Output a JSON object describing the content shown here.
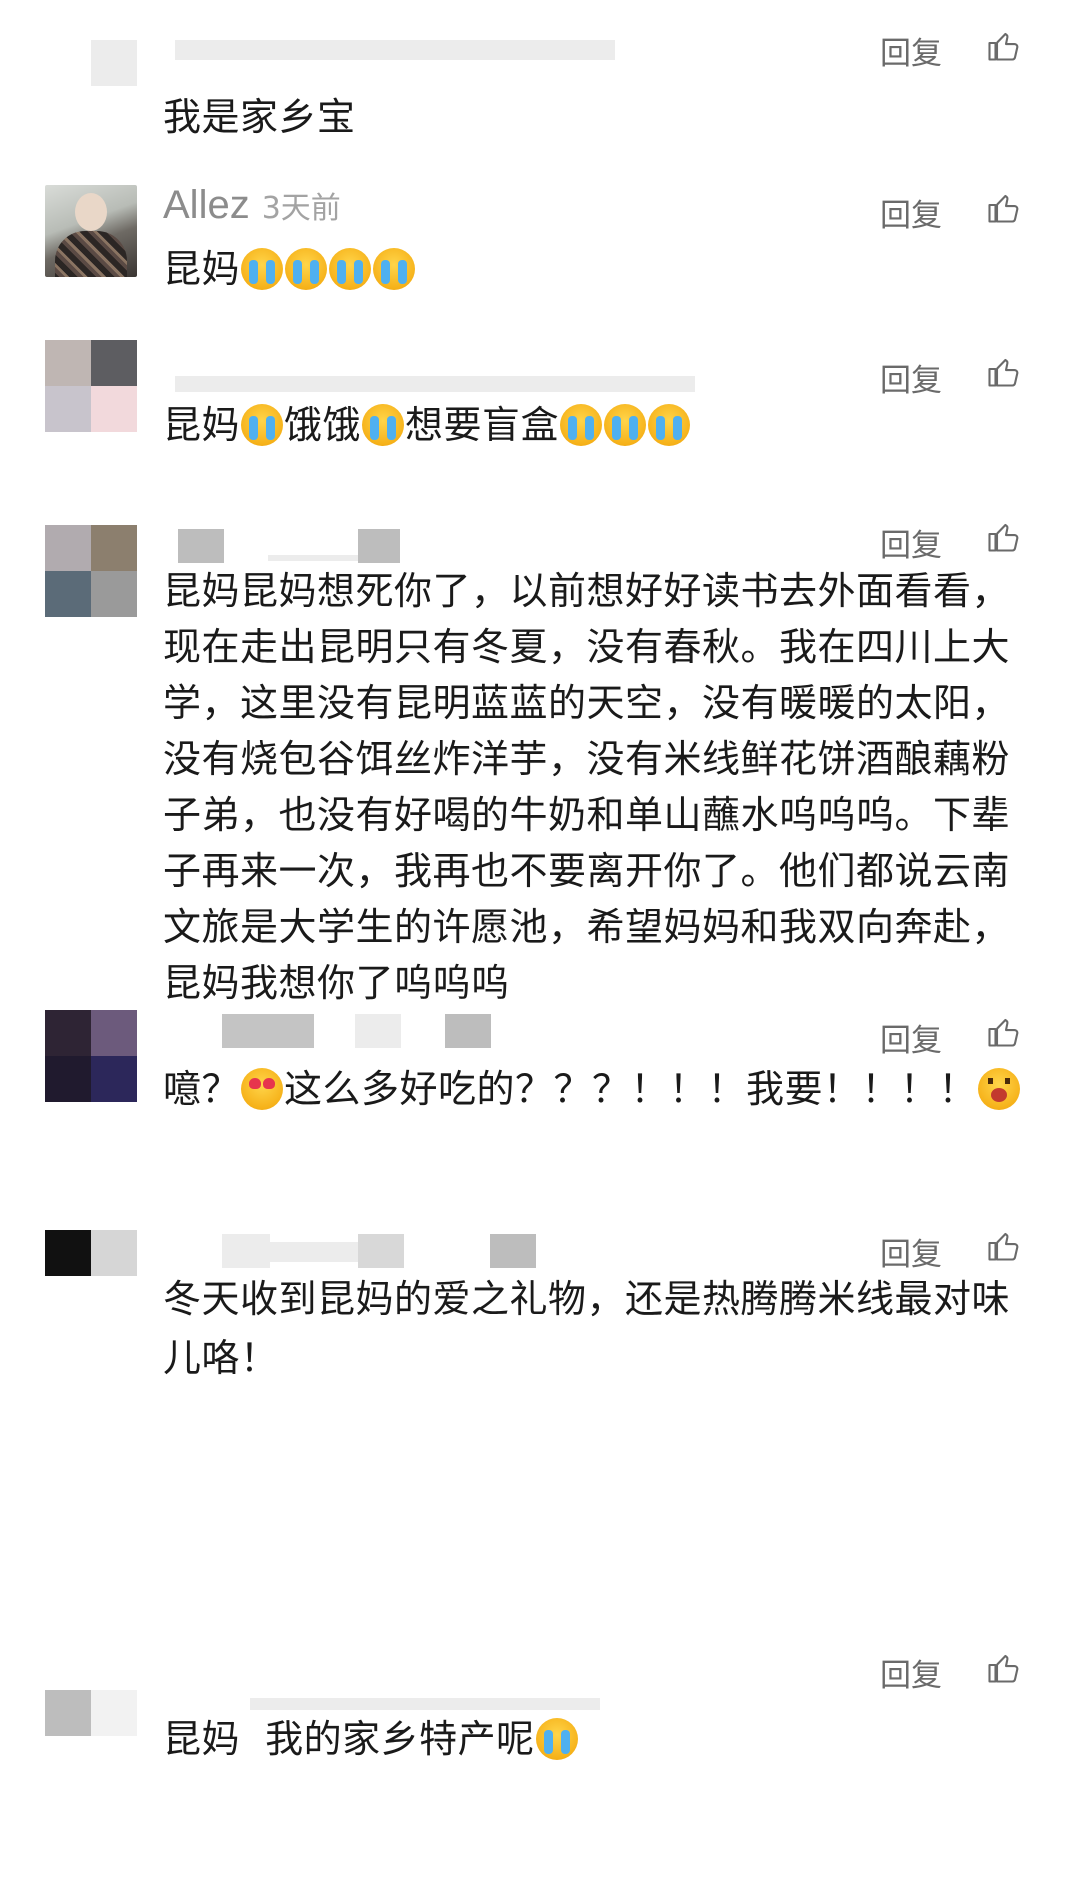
{
  "actions": {
    "reply_label": "回复"
  },
  "comments": [
    {
      "username": "",
      "time": "",
      "text": "我是家乡宝",
      "emojis": []
    },
    {
      "username": "Allez",
      "time": "3天前",
      "text": "昆妈",
      "emojis": [
        "loudly-crying-face",
        "loudly-crying-face",
        "loudly-crying-face",
        "loudly-crying-face"
      ]
    },
    {
      "username": "",
      "time": "",
      "segments": [
        "昆妈",
        "饿饿",
        "想要盲盒"
      ],
      "emojis": [
        "loudly-crying-face",
        "loudly-crying-face",
        "loudly-crying-face",
        "loudly-crying-face",
        "loudly-crying-face"
      ]
    },
    {
      "username": "",
      "time": "",
      "text": "昆妈昆妈想死你了，以前想好好读书去外面看看，现在走出昆明只有冬夏，没有春秋。我在四川上大学，这里没有昆明蓝蓝的天空，没有暖暖的太阳，没有烧包谷饵丝炸洋芋，没有米线鲜花饼酒酿藕粉子弟，也没有好喝的牛奶和单山蘸水呜呜呜。下辈子再来一次，我再也不要离开你了。他们都说云南文旅是大学生的许愿池，希望妈妈和我双向奔赴，昆妈我想你了呜呜呜",
      "emojis": []
    },
    {
      "username": "",
      "time": "",
      "segments": [
        "噫？",
        "这么多好吃的？？？！！！我要！！！！"
      ],
      "emojis": [
        "smiling-face-with-heart-eyes",
        "drooling-face"
      ]
    },
    {
      "username": "",
      "time": "",
      "text": "冬天收到昆妈的爱之礼物，还是热腾腾米线最对味儿咯！",
      "emojis": []
    },
    {
      "username": "",
      "time": "",
      "text": "昆妈  我的家乡特产呢",
      "emojis": [
        "loudly-crying-face"
      ]
    }
  ],
  "colors": {
    "text": "#1a1a1a",
    "meta": "#8c8c8c",
    "action": "#6a6a6a",
    "background": "#ffffff"
  }
}
